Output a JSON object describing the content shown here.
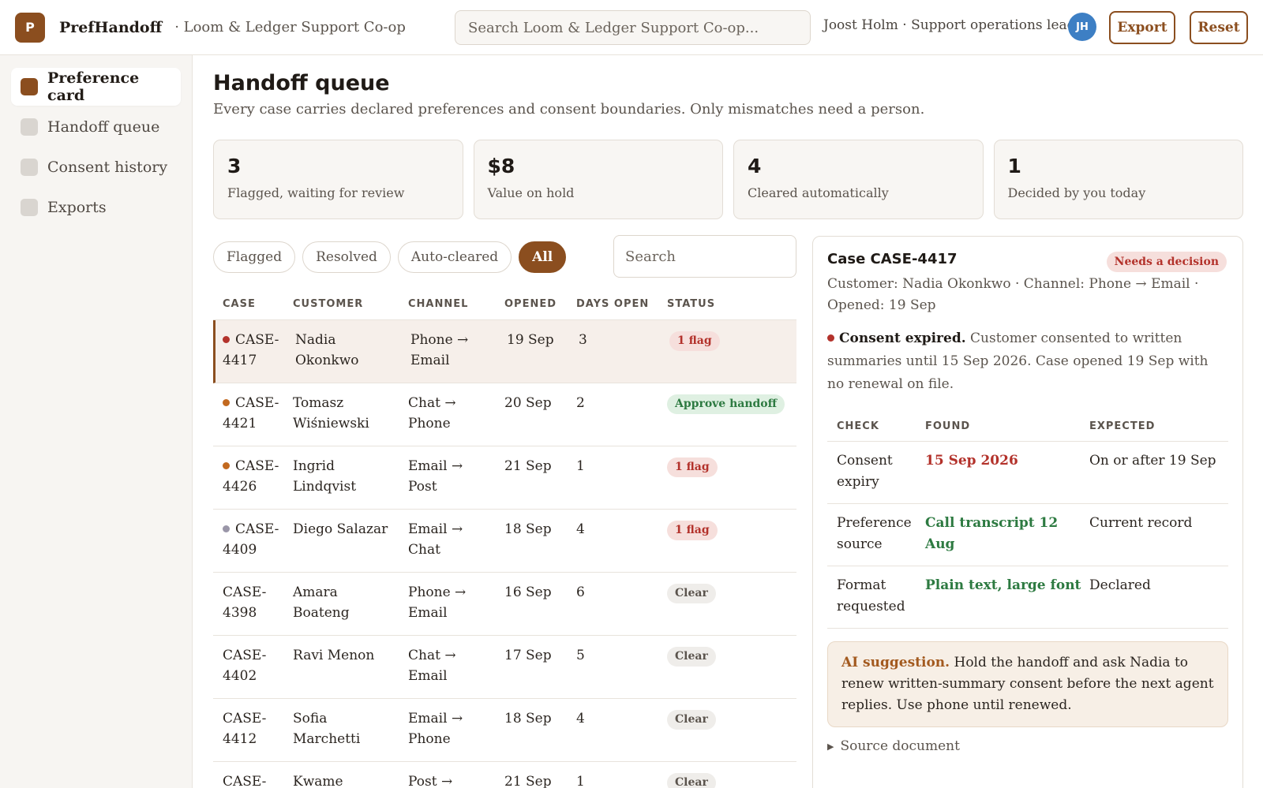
{
  "app": {
    "logo_letter": "P",
    "name": "PrefHandoff",
    "org": "· Loom & Ledger Support Co-op",
    "search_placeholder": "Search Loom & Ledger Support Co-op...",
    "user": "Joost Holm · Support operations lead",
    "avatar_initials": "JH",
    "export_label": "Export",
    "reset_label": "Reset"
  },
  "sidebar": {
    "items": [
      {
        "label": "Preference card",
        "active": true
      },
      {
        "label": "Handoff queue",
        "active": false
      },
      {
        "label": "Consent history",
        "active": false
      },
      {
        "label": "Exports",
        "active": false
      }
    ]
  },
  "page": {
    "title": "Handoff queue",
    "subtitle": "Every case carries declared preferences and consent boundaries. Only mismatches need a person."
  },
  "stats": [
    {
      "value": "3",
      "label": "Flagged, waiting for review"
    },
    {
      "value": "$8",
      "label": "Value on hold"
    },
    {
      "value": "4",
      "label": "Cleared automatically"
    },
    {
      "value": "1",
      "label": "Decided by you today"
    }
  ],
  "filters": {
    "chips": [
      "Flagged",
      "Resolved",
      "Auto-cleared",
      "All"
    ],
    "active": "All",
    "search_placeholder": "Search"
  },
  "queue": {
    "columns": [
      "CASE",
      "CUSTOMER",
      "CHANNEL",
      "OPENED",
      "DAYS OPEN",
      "STATUS"
    ],
    "rows": [
      {
        "case": "CASE-4417",
        "case_l1": "CASE-",
        "case_l2": "4417",
        "dot": "red",
        "cust_l1": "Nadia",
        "cust_l2": "Okonkwo",
        "chan_l1": "Phone →",
        "chan_l2": "Email",
        "opened": "19 Sep",
        "days": "3",
        "status": "1 flag",
        "status_type": "flag",
        "selected": true
      },
      {
        "case": "CASE-4421",
        "case_l1": "CASE-",
        "case_l2": "4421",
        "dot": "orange",
        "cust_l1": "Tomasz",
        "cust_l2": "Wiśniewski",
        "chan_l1": "Chat →",
        "chan_l2": "Phone",
        "opened": "20 Sep",
        "days": "2",
        "status": "Approve handoff",
        "status_type": "approve",
        "selected": false
      },
      {
        "case": "CASE-4426",
        "case_l1": "CASE-",
        "case_l2": "4426",
        "dot": "orange",
        "cust_l1": "Ingrid",
        "cust_l2": "Lindqvist",
        "chan_l1": "Email →",
        "chan_l2": "Post",
        "opened": "21 Sep",
        "days": "1",
        "status": "1 flag",
        "status_type": "flag",
        "selected": false
      },
      {
        "case": "CASE-4409",
        "case_l1": "CASE-",
        "case_l2": "4409",
        "dot": "gray",
        "cust_l1": "Diego Salazar",
        "cust_l2": "",
        "chan_l1": "Email →",
        "chan_l2": "Chat",
        "opened": "18 Sep",
        "days": "4",
        "status": "1 flag",
        "status_type": "flag",
        "selected": false
      },
      {
        "case": "CASE-4398",
        "case_l1": "CASE-",
        "case_l2": "4398",
        "dot": "",
        "cust_l1": "Amara",
        "cust_l2": "Boateng",
        "chan_l1": "Phone →",
        "chan_l2": "Email",
        "opened": "16 Sep",
        "days": "6",
        "status": "Clear",
        "status_type": "clear",
        "selected": false
      },
      {
        "case": "CASE-4402",
        "case_l1": "CASE-",
        "case_l2": "4402",
        "dot": "",
        "cust_l1": "Ravi Menon",
        "cust_l2": "",
        "chan_l1": "Chat →",
        "chan_l2": "Email",
        "opened": "17 Sep",
        "days": "5",
        "status": "Clear",
        "status_type": "clear",
        "selected": false
      },
      {
        "case": "CASE-4412",
        "case_l1": "CASE-",
        "case_l2": "4412",
        "dot": "",
        "cust_l1": "Sofia",
        "cust_l2": "Marchetti",
        "chan_l1": "Email →",
        "chan_l2": "Phone",
        "opened": "18 Sep",
        "days": "4",
        "status": "Clear",
        "status_type": "clear",
        "selected": false
      },
      {
        "case": "CASE-",
        "case_l1": "CASE-",
        "case_l2": "",
        "dot": "",
        "cust_l1": "Kwame",
        "cust_l2": "",
        "chan_l1": "Post →",
        "chan_l2": "",
        "opened": "21 Sep",
        "days": "1",
        "status": "Clear",
        "status_type": "clear",
        "selected": false
      }
    ]
  },
  "detail": {
    "title": "Case CASE-4417",
    "badge": "Needs a decision",
    "meta": "Customer: Nadia Okonkwo · Channel: Phone → Email · Opened: 19 Sep",
    "alert_title": "Consent expired.",
    "alert_text": "Customer consented to written summaries until 15 Sep 2026. Case opened 19 Sep with no renewal on file.",
    "checks_columns": [
      "CHECK",
      "FOUND",
      "EXPECTED"
    ],
    "checks": [
      {
        "check_l1": "Consent",
        "check_l2": "expiry",
        "found": "15 Sep 2026",
        "found_type": "red",
        "expected": "On or after 19 Sep"
      },
      {
        "check_l1": "Preference",
        "check_l2": "source",
        "found": "Call transcript 12 Aug",
        "found_type": "green",
        "expected": "Current record"
      },
      {
        "check_l1": "Format",
        "check_l2": "requested",
        "found": "Plain text, large font",
        "found_type": "green",
        "expected": "Declared"
      }
    ],
    "ai_label": "AI suggestion.",
    "ai_text": "Hold the handoff and ask Nadia to renew written-summary consent before the next agent replies. Use phone until renewed.",
    "source_label": "Source document"
  },
  "colors": {
    "accent": "#8b4e1f",
    "flag_red": "#b3322b",
    "ok_green": "#2d7a41",
    "avatar_blue": "#3d7fc4"
  }
}
